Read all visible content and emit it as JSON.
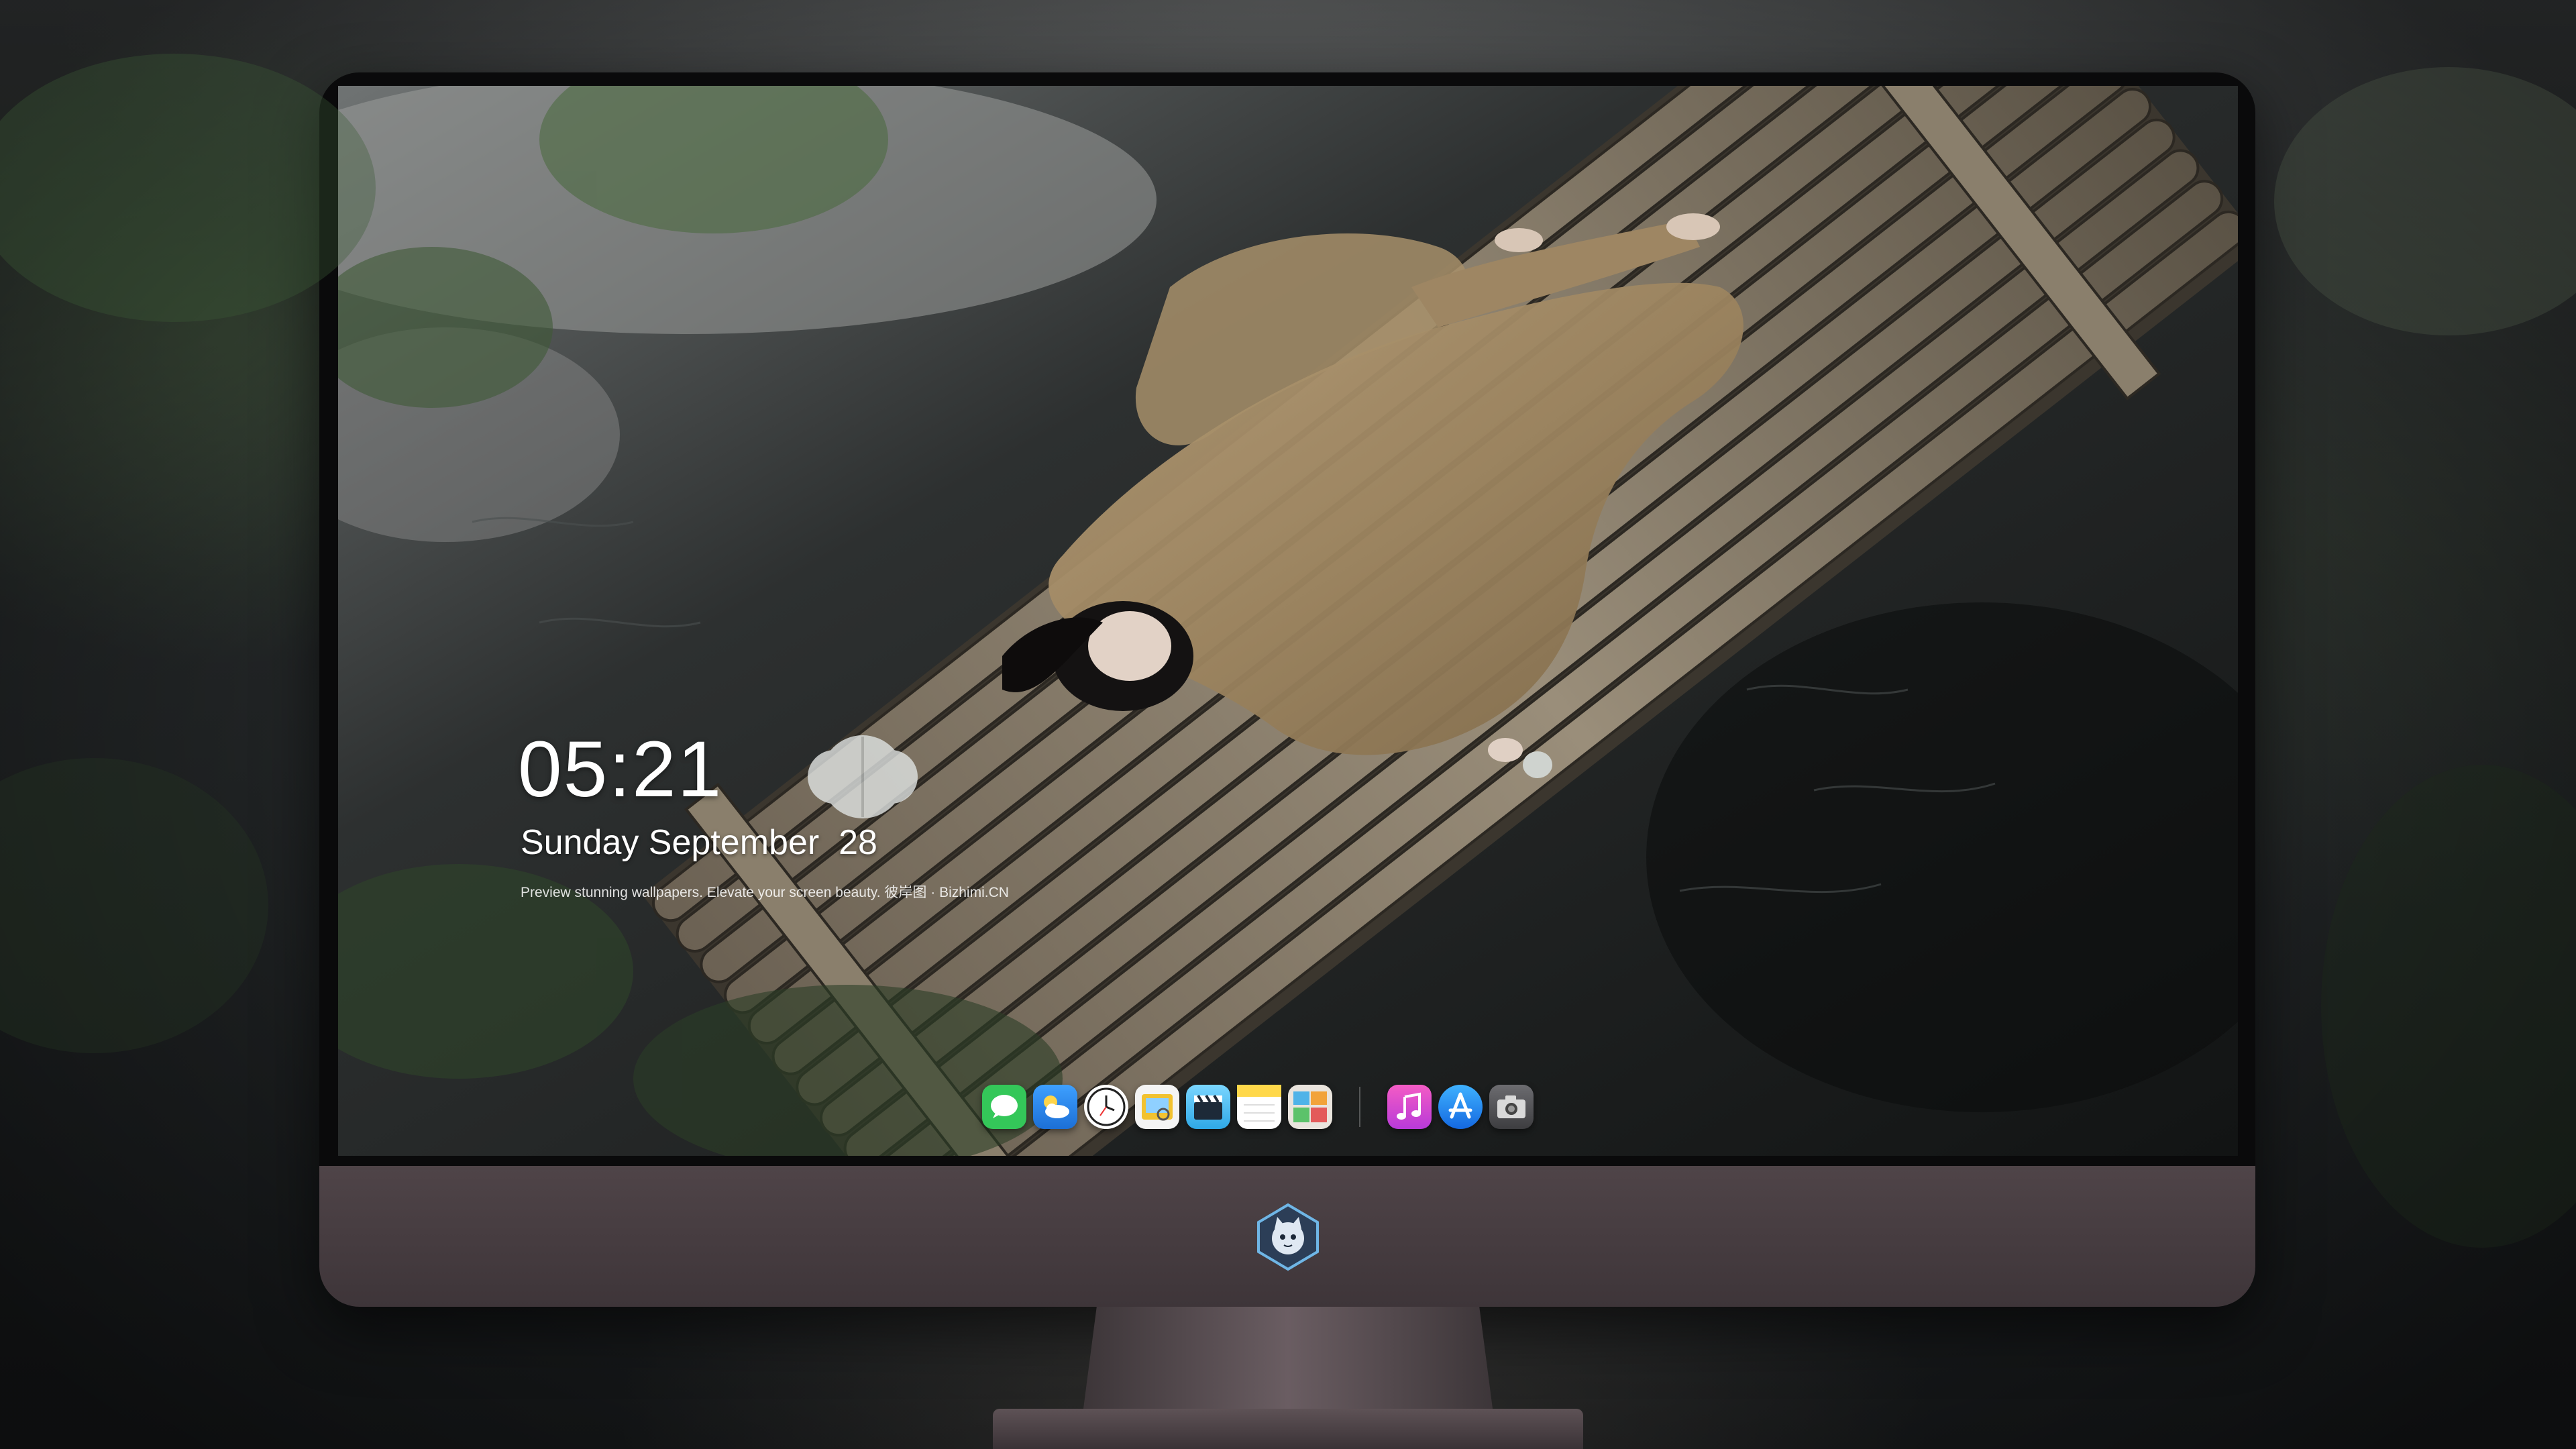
{
  "lockscreen": {
    "time": "05:21",
    "date": "Sunday September  28",
    "caption": "Preview stunning wallpapers. Elevate your screen beauty. 彼岸图 · Bizhimi.CN"
  },
  "dock": {
    "apps": [
      {
        "icon": "messages-icon",
        "color": "#34c759"
      },
      {
        "icon": "weather-icon",
        "color": "#2f8ef0"
      },
      {
        "icon": "clock-icon",
        "color": "#ffffff"
      },
      {
        "icon": "preview-icon",
        "color": "#f2c230"
      },
      {
        "icon": "claquette-icon",
        "color": "#5ac8fa"
      },
      {
        "icon": "notes-icon",
        "color": "#ffd84a"
      },
      {
        "icon": "photo-board-icon",
        "color": "#e9e4dd"
      },
      {
        "icon": "music-icon",
        "color": "#e24fb5"
      },
      {
        "icon": "app-store-icon",
        "color": "#1c8cf5"
      },
      {
        "icon": "screenshot-icon",
        "color": "#5a5a5e"
      }
    ]
  },
  "monitor": {
    "logo": "cat-mascot-icon"
  }
}
